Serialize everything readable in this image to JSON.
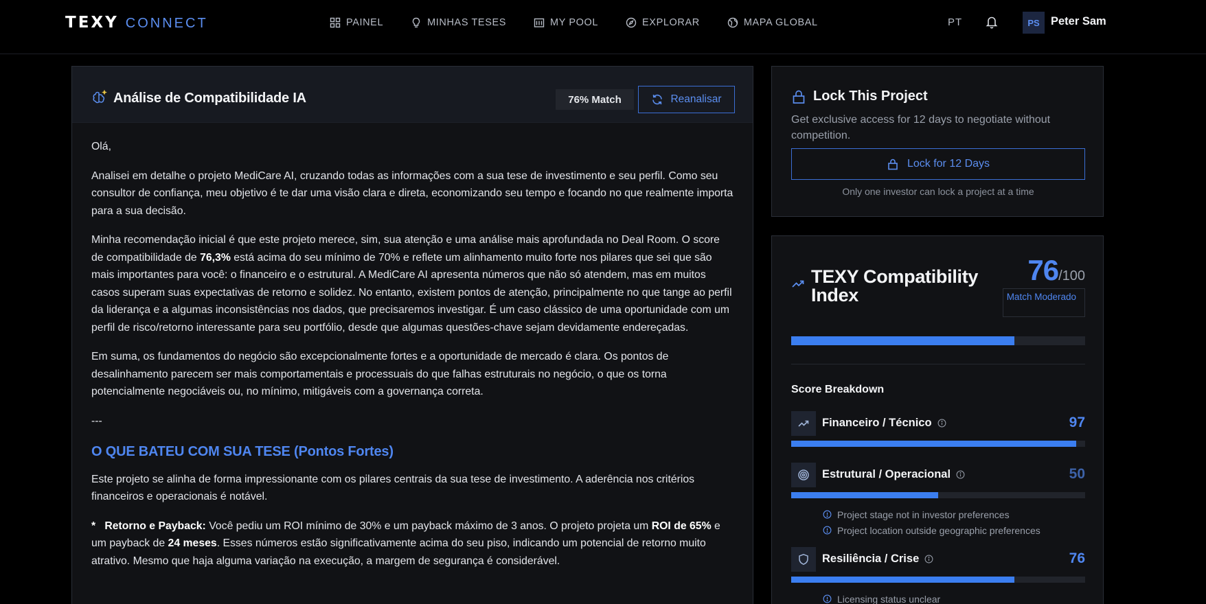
{
  "nav": {
    "logo_main": "TEXY",
    "logo_sub": "CONNECT",
    "items": [
      {
        "label": "PAINEL",
        "icon": "grid-icon"
      },
      {
        "label": "MINHAS TESES",
        "icon": "lightbulb-icon"
      },
      {
        "label": "MY POOL",
        "icon": "building-icon"
      },
      {
        "label": "EXPLORAR",
        "icon": "compass-icon"
      },
      {
        "label": "MAPA GLOBAL",
        "icon": "globe-icon"
      }
    ],
    "language": "PT",
    "avatar_initials": "PS",
    "user_name": "Peter Sam"
  },
  "analysis": {
    "title": "Análise de Compatibilidade IA",
    "match_label": "76% Match",
    "reanalyze_label": "Reanalisar",
    "greeting": "Olá,",
    "p1": "Analisei em detalhe o projeto MediCare AI, cruzando todas as informações com a sua tese de investimento e seu perfil. Como seu consultor de confiança, meu objetivo é te dar uma visão clara e direta, economizando seu tempo e focando no que realmente importa para a sua decisão.",
    "p2_a": "Minha recomendação inicial é que este projeto merece, sim, sua atenção e uma análise mais aprofundada no Deal Room. O score de compatibilidade de ",
    "p2_bold": "76,3%",
    "p2_b": " está acima do seu mínimo de 70% e reflete um alinhamento muito forte nos pilares que sei que são mais importantes para você: o financeiro e o estrutural. A MediCare AI apresenta números que não só atendem, mas em muitos casos superam suas expectativas de retorno e solidez. No entanto, existem pontos de atenção, principalmente no que tange ao perfil da liderança e a algumas inconsistências nos dados, que precisaremos investigar. É um caso clássico de uma oportunidade com um perfil de risco/retorno interessante para seu portfólio, desde que algumas questões-chave sejam devidamente endereçadas.",
    "p3": "Em suma, os fundamentos do negócio são excepcionalmente fortes e a oportunidade de mercado é clara. Os pontos de desalinhamento parecem ser mais comportamentais e processuais do que falhas estruturais no negócio, o que os torna potencialmente negociáveis ou, no mínimo, mitigáveis com a governança correta.",
    "separator": "---",
    "section_title": "O QUE BATEU COM SUA TESE (Pontos Fortes)",
    "p4": "Este projeto se alinha de forma impressionante com os pilares centrais da sua tese de investimento. A aderência nos critérios financeiros e operacionais é notável.",
    "bullet_marker": "*",
    "bullet_label": "Retorno e Payback:",
    "bullet_a": " Você pediu um ROI mínimo de 30% e um payback máximo de 3 anos. O projeto projeta um ",
    "bullet_bold1": "ROI de 65%",
    "bullet_b": " e um payback de ",
    "bullet_bold2": "24 meses",
    "bullet_c": ". Esses números estão significativamente acima do seu piso, indicando um potencial de retorno muito atrativo. Mesmo que haja alguma variação na execução, a margem de segurança é considerável."
  },
  "lock": {
    "title": "Lock This Project",
    "description": "Get exclusive access for 12 days to negotiate without competition.",
    "button_label": "Lock for 12 Days",
    "note": "Only one investor can lock a project at a time"
  },
  "index": {
    "title": "TEXY Compatibility Index",
    "score": "76",
    "score_max": "/100",
    "score_fraction": 0.76,
    "match_badge": "Match Moderado",
    "breakdown_title": "Score Breakdown",
    "items": [
      {
        "label": "Financeiro / Técnico",
        "score": "97",
        "fraction": 0.97,
        "icon": "trend-up-icon",
        "score_color": "#4f86f0",
        "notes": []
      },
      {
        "label": "Estrutural / Operacional",
        "score": "50",
        "fraction": 0.5,
        "icon": "target-icon",
        "score_color": "#3d62a8",
        "notes": [
          "Project stage not in investor preferences",
          "Project location outside geographic preferences"
        ]
      },
      {
        "label": "Resiliência / Crise",
        "score": "76",
        "fraction": 0.76,
        "icon": "shield-icon",
        "score_color": "#4f86f0",
        "notes": [
          "Licensing status unclear"
        ]
      }
    ]
  },
  "colors": {
    "accent": "#4f86f0",
    "bar": "#3b7ef0",
    "panel": "#111215"
  }
}
